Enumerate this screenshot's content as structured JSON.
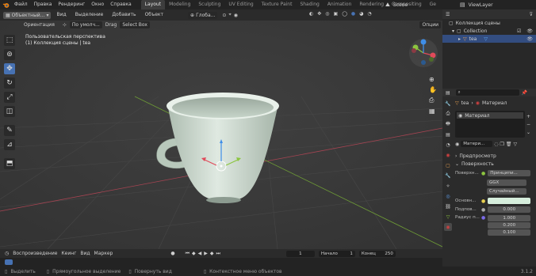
{
  "topbar": {
    "menus": [
      "Файл",
      "Правка",
      "Рендеринг",
      "Окно",
      "Справка"
    ],
    "tabs": [
      "Layout",
      "Modeling",
      "Sculpting",
      "UV Editing",
      "Texture Paint",
      "Shading",
      "Animation",
      "Rendering",
      "Compositing",
      "Ge"
    ],
    "active_tab": "Layout",
    "scene": "Scene",
    "view_layer": "ViewLayer"
  },
  "viewport_header": {
    "mode": "Объектный...",
    "menus": [
      "Вид",
      "Выделение",
      "Добавить",
      "Объект"
    ],
    "transform": "Глоба..."
  },
  "tool_header": {
    "orientation_label": "Ориентация",
    "orientation_value": "По умолч...",
    "drag_label": "Drag",
    "drag_value": "Select Box",
    "options": "Опции"
  },
  "viewport": {
    "perspective": "Пользовательская перспектива",
    "collection_info": "(1) Коллекция сцены | tea"
  },
  "outliner": {
    "root": "Коллекция сцены",
    "collection": "Collection",
    "object": "tea"
  },
  "properties": {
    "object_name": "tea",
    "material_breadcrumb": "Материал",
    "slot_name": "Материал",
    "material_field": "Матери...",
    "preview": "Предпросмотр",
    "surface": "Поверхность",
    "surface_label": "Поверхн...",
    "surface_value": "Принципи...",
    "distribution": "GGX",
    "subsurface_method": "Случайный...",
    "base_color_label": "Основн...",
    "subsurface_label": "Подпов...",
    "subsurface_value": "0.000",
    "radius_label": "Радиус п...",
    "radius_values": [
      "1.000",
      "0.200",
      "0.100"
    ],
    "base_color": "#d6eedc"
  },
  "timeline": {
    "playback": "Воспроизведение",
    "keying": "Кеинг",
    "view": "Вид",
    "marker": "Маркер",
    "current_frame": "1",
    "start_label": "Начало",
    "start_value": "1",
    "end_label": "Конец",
    "end_value": "250"
  },
  "statusbar": {
    "select": "Выделить",
    "box_select": "Прямоугольное выделение",
    "rotate_view": "Повернуть вид",
    "context_menu": "Контекстное меню объектов",
    "version": "3.1.2"
  },
  "colors": {
    "accent": "#4772b3",
    "cup": "#c9d8cc",
    "axis_x": "#e04a5a",
    "axis_y": "#8cc53f",
    "axis_z": "#3f8ee8"
  }
}
